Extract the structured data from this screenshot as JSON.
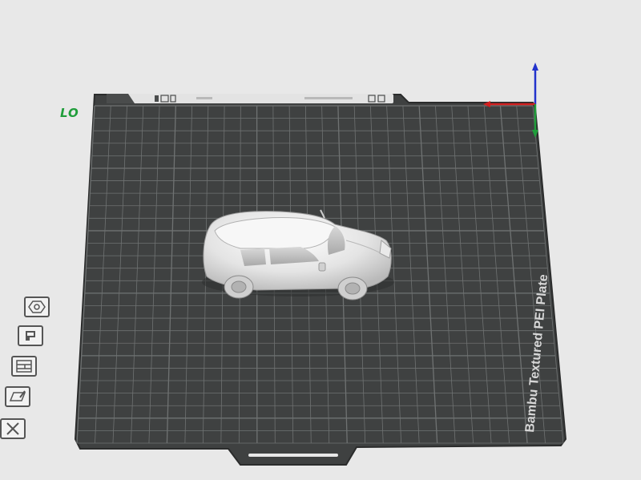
{
  "plate": {
    "name_label": "LO",
    "bed_text": "Bambu Textured PEI Plate"
  },
  "model": {
    "name": "car-model"
  },
  "axes": {
    "x_color": "#d21f1f",
    "y_color": "#1f9d3a",
    "z_color": "#2233cc"
  },
  "side_toolbar": {
    "items": [
      {
        "name": "orient-tool-button",
        "icon": "hexagon-icon"
      },
      {
        "name": "arrange-tool-button",
        "icon": "bucket-icon"
      },
      {
        "name": "layout-tool-button",
        "icon": "layers-icon"
      },
      {
        "name": "edit-tool-button",
        "icon": "edit-plate-icon"
      },
      {
        "name": "close-tool-button",
        "icon": "close-icon"
      }
    ]
  },
  "colors": {
    "bed": "#3f4141",
    "grid": "#6f7272",
    "background": "#e8e8e8"
  }
}
